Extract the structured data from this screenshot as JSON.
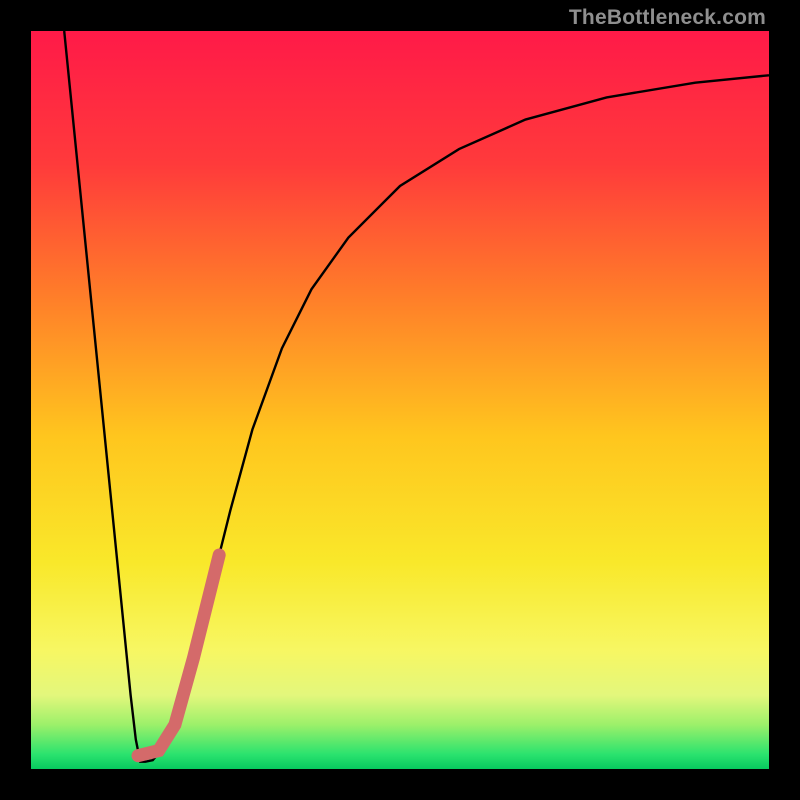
{
  "watermark": "TheBottleneck.com",
  "chart_data": {
    "type": "line",
    "title": "",
    "xlabel": "",
    "ylabel": "",
    "xlim": [
      0,
      100
    ],
    "ylim": [
      0,
      100
    ],
    "background_gradient": {
      "stops": [
        {
          "offset": 0.0,
          "color": "#ff1a48"
        },
        {
          "offset": 0.18,
          "color": "#ff3a3b"
        },
        {
          "offset": 0.35,
          "color": "#ff7a2a"
        },
        {
          "offset": 0.55,
          "color": "#ffc61e"
        },
        {
          "offset": 0.72,
          "color": "#f9e82a"
        },
        {
          "offset": 0.84,
          "color": "#f7f763"
        },
        {
          "offset": 0.9,
          "color": "#e3f77c"
        },
        {
          "offset": 0.94,
          "color": "#9cf06a"
        },
        {
          "offset": 0.98,
          "color": "#2be36e"
        },
        {
          "offset": 1.0,
          "color": "#07c95f"
        }
      ]
    },
    "series": [
      {
        "name": "bottleneck-curve",
        "stroke": "#000000",
        "stroke_width": 2.4,
        "points": [
          {
            "x": 4.5,
            "y": 100.0
          },
          {
            "x": 5.5,
            "y": 90.0
          },
          {
            "x": 6.5,
            "y": 80.0
          },
          {
            "x": 7.5,
            "y": 70.0
          },
          {
            "x": 8.5,
            "y": 60.0
          },
          {
            "x": 9.5,
            "y": 50.0
          },
          {
            "x": 10.5,
            "y": 40.0
          },
          {
            "x": 11.5,
            "y": 30.0
          },
          {
            "x": 12.5,
            "y": 20.0
          },
          {
            "x": 13.5,
            "y": 10.0
          },
          {
            "x": 14.2,
            "y": 4.0
          },
          {
            "x": 14.8,
            "y": 1.0
          },
          {
            "x": 15.5,
            "y": 1.0
          },
          {
            "x": 16.5,
            "y": 1.2
          },
          {
            "x": 18.0,
            "y": 3.0
          },
          {
            "x": 20.0,
            "y": 8.0
          },
          {
            "x": 22.0,
            "y": 15.0
          },
          {
            "x": 24.0,
            "y": 23.0
          },
          {
            "x": 27.0,
            "y": 35.0
          },
          {
            "x": 30.0,
            "y": 46.0
          },
          {
            "x": 34.0,
            "y": 57.0
          },
          {
            "x": 38.0,
            "y": 65.0
          },
          {
            "x": 43.0,
            "y": 72.0
          },
          {
            "x": 50.0,
            "y": 79.0
          },
          {
            "x": 58.0,
            "y": 84.0
          },
          {
            "x": 67.0,
            "y": 88.0
          },
          {
            "x": 78.0,
            "y": 91.0
          },
          {
            "x": 90.0,
            "y": 93.0
          },
          {
            "x": 100.0,
            "y": 94.0
          }
        ]
      },
      {
        "name": "highlight-segment",
        "stroke": "#d46a6a",
        "stroke_width": 13,
        "linecap": "round",
        "points": [
          {
            "x": 14.5,
            "y": 1.8
          },
          {
            "x": 17.3,
            "y": 2.5
          },
          {
            "x": 19.5,
            "y": 6.0
          },
          {
            "x": 22.0,
            "y": 15.0
          },
          {
            "x": 25.5,
            "y": 29.0
          }
        ]
      }
    ],
    "annotations": []
  }
}
